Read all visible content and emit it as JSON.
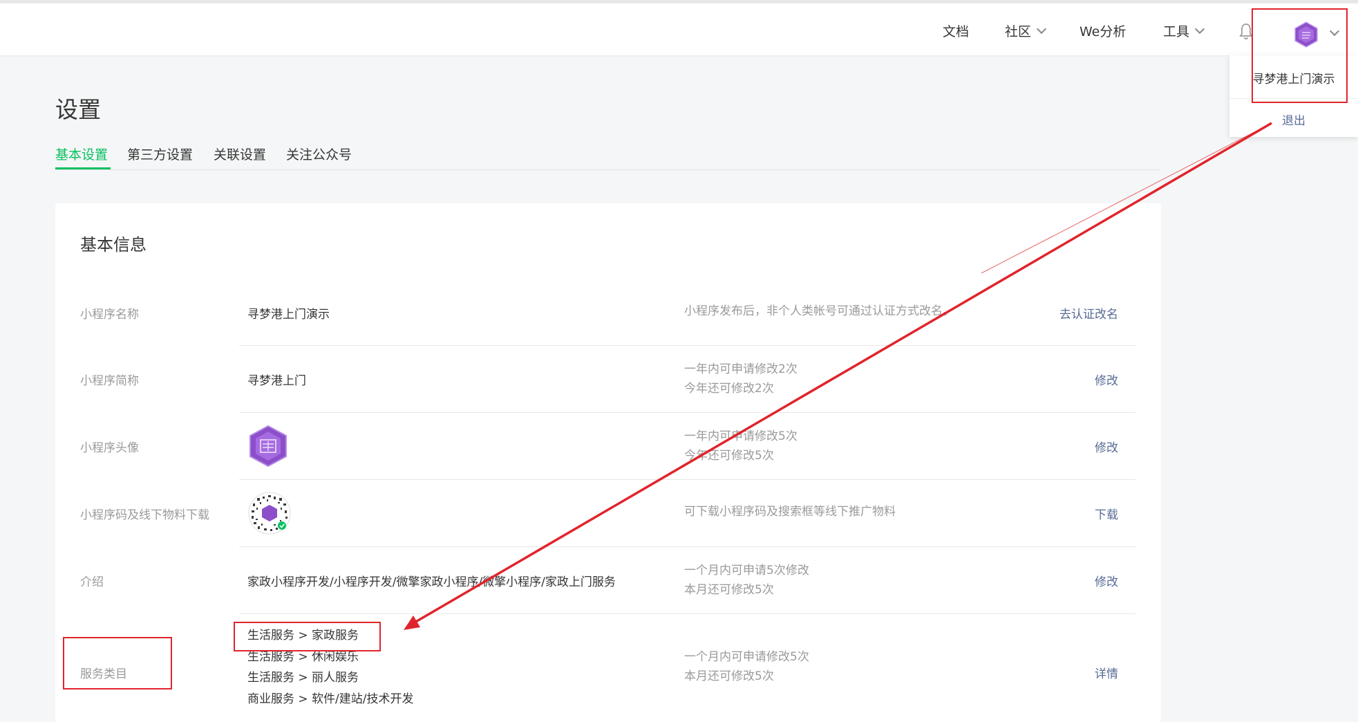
{
  "topbar": {
    "nav": [
      {
        "label": "文档",
        "has_dropdown": false
      },
      {
        "label": "社区",
        "has_dropdown": true
      },
      {
        "label": "We分析",
        "has_dropdown": false
      },
      {
        "label": "工具",
        "has_dropdown": true
      }
    ],
    "notification_icon": "bell-icon",
    "avatar_icon": "hexagon-avatar-icon",
    "avatar_color": "#8c4fc9"
  },
  "account_menu": {
    "account_name": "寻梦港上门演示",
    "logout_label": "退出"
  },
  "page": {
    "title": "设置",
    "tabs": [
      {
        "label": "基本设置",
        "active": true
      },
      {
        "label": "第三方设置",
        "active": false
      },
      {
        "label": "关联设置",
        "active": false
      },
      {
        "label": "关注公众号",
        "active": false
      }
    ],
    "accent_color": "#07c160",
    "link_color": "#576b95"
  },
  "basic_info": {
    "title": "基本信息",
    "rows": [
      {
        "label": "小程序名称",
        "value": "寻梦港上门演示",
        "tip_lines": [
          "小程序发布后，非个人类帐号可通过认证方式改名。"
        ],
        "action": "去认证改名"
      },
      {
        "label": "小程序简称",
        "value": "寻梦港上门",
        "tip_lines": [
          "一年内可申请修改2次",
          "今年还可修改2次"
        ],
        "action": "修改"
      },
      {
        "label": "小程序头像",
        "value": "",
        "tip_lines": [
          "一年内可申请修改5次",
          "今年还可修改5次"
        ],
        "action": "修改"
      },
      {
        "label": "小程序码及线下物料下载",
        "value": "",
        "tip_lines": [
          "可下载小程序码及搜索框等线下推广物料"
        ],
        "action": "下载"
      },
      {
        "label": "介绍",
        "value": "家政小程序开发/小程序开发/微擎家政小程序/微擎小程序/家政上门服务",
        "tip_lines": [
          "一个月内可申请5次修改",
          "本月还可修改5次"
        ],
        "action": "修改"
      },
      {
        "label": "服务类目",
        "value": "",
        "tip_lines": [
          "一个月内可申请修改5次",
          "本月还可修改5次"
        ],
        "action": "详情"
      }
    ],
    "service_categories": [
      "生活服务 > 家政服务",
      "生活服务 > 休闲娱乐",
      "生活服务 > 丽人服务",
      "商业服务 > 软件/建站/技术开发"
    ]
  },
  "annotation_color": "#e0242b"
}
